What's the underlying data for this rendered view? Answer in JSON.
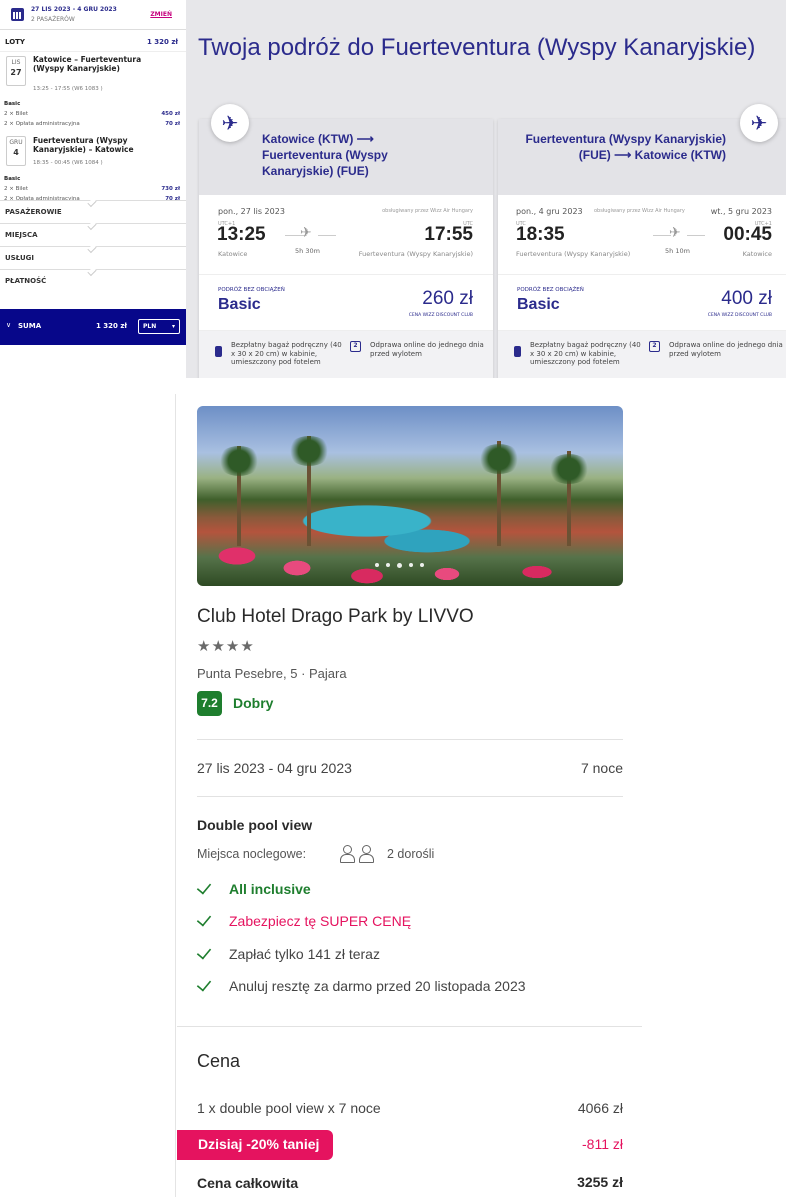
{
  "flight_sidebar": {
    "dates": "27 LIS 2023 - 4 GRU 2023",
    "passengers": "2 PASAŻERÓW",
    "change": "ZMIEŃ",
    "flights_label": "LOTY",
    "flights_total": "1 320 zł",
    "legs": [
      {
        "month": "LIS",
        "day": "27",
        "route": "Katowice – Fuerteventura (Wyspy Kanaryjskie)",
        "time": "13:25 - 17:55 (W6 1083 )",
        "fare": "Basic",
        "items": [
          {
            "label": "2 × Bilet",
            "value": "450 zł"
          },
          {
            "label": "2 × Opłata administracyjna",
            "value": "70 zł"
          }
        ]
      },
      {
        "month": "GRU",
        "day": "4",
        "route": "Fuerteventura (Wyspy Kanaryjskie) – Katowice",
        "time": "18:35 - 00:45 (W6 1084 )",
        "fare": "Basic",
        "items": [
          {
            "label": "2 × Bilet",
            "value": "730 zł"
          },
          {
            "label": "2 × Opłata administracyjna",
            "value": "70 zł"
          }
        ]
      }
    ],
    "sections": [
      "PASAŻEROWIE",
      "MIEJSCA",
      "USŁUGI",
      "PŁATNOŚĆ"
    ],
    "total_label": "SUMA",
    "total_value": "1 320 zł",
    "currency": "PLN"
  },
  "flights_main": {
    "title": "Twoja podróż do Fuerteventura (Wyspy Kanaryjskie)",
    "cards": [
      {
        "header_route": "Katowice (KTW) ⟶ Fuerteventura (Wyspy Kanaryjskie) (FUE)",
        "date": "pon., 27 lis 2023",
        "operated_by": "obsługiwany przez Wizz Air Hungary",
        "date_right": "",
        "utc_left": "UTC+1",
        "utc_right": "UTC",
        "dep_time": "13:25",
        "arr_time": "17:55",
        "dep_city": "Katowice",
        "arr_city": "Fuerteventura (Wyspy Kanaryjskie)",
        "duration": "5h 30m",
        "fare_caption": "PODRÓŻ BEZ OBCIĄŻEŃ",
        "fare": "Basic",
        "price": "260 zł",
        "club": "CENA WIZZ DISCOUNT CLUB",
        "bag_text": "Bezpłatny bagaż podręczny (40 x 30 x 20 cm) w kabinie, umieszczony pod fotelem",
        "checkin_icon": "2",
        "checkin_text": "Odprawa online do jednego dnia przed wylotem"
      },
      {
        "header_route": "Fuerteventura (Wyspy Kanaryjskie) (FUE) ⟶ Katowice (KTW)",
        "date": "pon., 4 gru 2023",
        "operated_by": "obsługiwany przez Wizz Air Hungary",
        "date_right": "wt., 5 gru 2023",
        "utc_left": "UTC",
        "utc_right": "UTC+1",
        "dep_time": "18:35",
        "arr_time": "00:45",
        "dep_city": "Fuerteventura (Wyspy Kanaryjskie)",
        "arr_city": "Katowice",
        "duration": "5h 10m",
        "fare_caption": "PODRÓŻ BEZ OBCIĄŻEŃ",
        "fare": "Basic",
        "price": "400 zł",
        "club": "CENA WIZZ DISCOUNT CLUB",
        "bag_text": "Bezpłatny bagaż podręczny (40 x 30 x 20 cm) w kabinie, umieszczony pod fotelem",
        "checkin_icon": "2",
        "checkin_text": "Odprawa online do jednego dnia przed wylotem"
      }
    ]
  },
  "hotel": {
    "name": "Club Hotel Drago Park by LIVVO",
    "stars": "★★★★",
    "address": "Punta Pesebre, 5 · Pajara",
    "score": "7.2",
    "score_label": "Dobry",
    "dates": "27 lis 2023 - 04 gru 2023",
    "nights": "7 noce",
    "room": "Double pool view",
    "beds_label": "Miejsca noclegowe:",
    "adults": "2 dorośli",
    "features": [
      {
        "text": "All inclusive",
        "color": "#1e7e2e",
        "bold": true
      },
      {
        "text": "Zabezpiecz tę SUPER CENĘ",
        "color": "#e5135f",
        "bold": false
      },
      {
        "text": "Zapłać tylko 141 zł teraz",
        "color": "#444444",
        "bold": false
      },
      {
        "text": "Anuluj resztę za darmo przed 20 listopada 2023",
        "color": "#444444",
        "bold": false
      }
    ],
    "price_header": "Cena",
    "line_item": "1 x double pool view x 7 noce",
    "line_value": "4066 zł",
    "promo": "Dzisiaj -20% taniej",
    "promo_value": "-811 zł",
    "total_label": "Cena całkowita",
    "total_value": "3255 zł"
  },
  "colors": {
    "wizz_blue": "#2b2b8c",
    "wizz_navy": "#07078a",
    "wizz_pink": "#c6007e",
    "green": "#1e7e2e",
    "promo_pink": "#e5135f"
  }
}
